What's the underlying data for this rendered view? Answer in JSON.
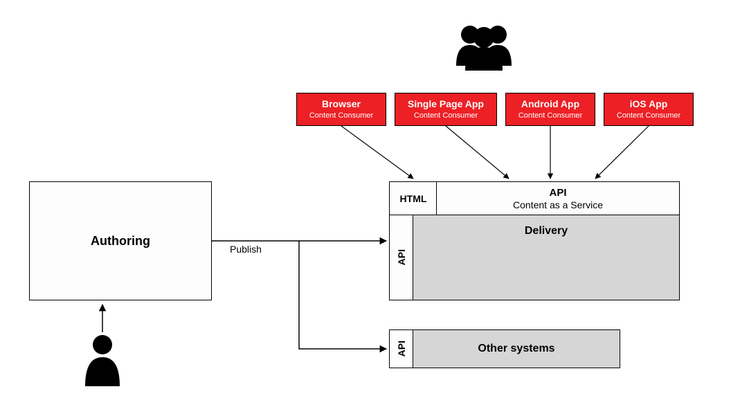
{
  "consumers": [
    {
      "title": "Browser",
      "subtitle": "Content Consumer"
    },
    {
      "title": "Single Page App",
      "subtitle": "Content Consumer"
    },
    {
      "title": "Android App",
      "subtitle": "Content Consumer"
    },
    {
      "title": "iOS App",
      "subtitle": "Content Consumer"
    }
  ],
  "authoring": {
    "label": "Authoring"
  },
  "publish_label": "Publish",
  "delivery_block": {
    "html_label": "HTML",
    "api_label": "API",
    "api_sub": "Content as a Service",
    "side_api_label": "API",
    "delivery_label": "Delivery"
  },
  "other_systems": {
    "side_api_label": "API",
    "label": "Other systems"
  },
  "colors": {
    "consumer_bg": "#ed2025",
    "grey_bg": "#d6d6d6"
  }
}
